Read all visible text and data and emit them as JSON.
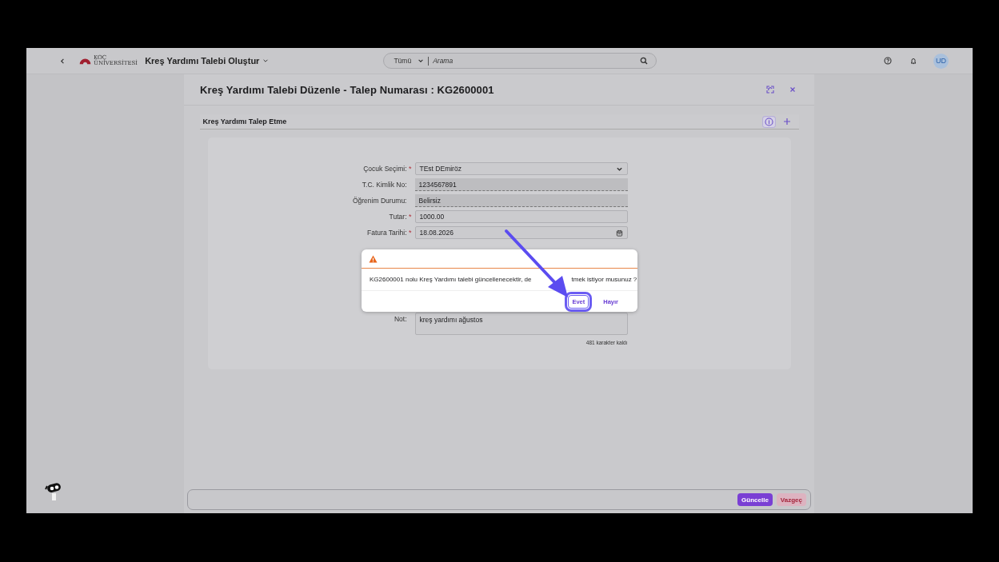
{
  "header": {
    "logo_lines": [
      "KOÇ",
      "ÜNİVERSİTESİ"
    ],
    "app_title": "Kreş Yardımı Talebi Oluştur",
    "search": {
      "scope": "Tümü",
      "placeholder": "Arama"
    },
    "avatar": "UD"
  },
  "page_title": "Kreş Yardımı Talebi Düzenle - Talep Numarası : KG2600001",
  "section_title": "Kreş Yardımı Talep Etme",
  "fields": [
    {
      "label": "Çocuk Seçimi:",
      "required_mark": "*",
      "kind": "select",
      "value": "TEst DEmiröz"
    },
    {
      "label": "T.C. Kimlik No:",
      "kind": "readonly",
      "value": "1234567891"
    },
    {
      "label": "Öğrenim Durumu:",
      "kind": "readonly",
      "value": "Belirsiz"
    },
    {
      "label": "Tutar:",
      "required_mark": "*",
      "kind": "text",
      "value": "1000.00"
    },
    {
      "label": "Fatura Tarihi:",
      "required_mark": "*",
      "kind": "date",
      "value": "18.08.2026"
    }
  ],
  "note": {
    "label": "Not:",
    "value": "kreş yardımı ağustos",
    "counter": "481 karakter kaldı"
  },
  "dialog": {
    "message_visible_parts": [
      "KG2600001 nolu Kreş Yardımı talebi güncellenecektir, de",
      "tmek istiyor musunuz ?"
    ],
    "buttons": [
      {
        "label": "Evet",
        "highlighted": true
      },
      {
        "label": "Hayır",
        "highlighted": false
      }
    ]
  },
  "footer_buttons": [
    {
      "label": "Güncelle",
      "kind": "primary"
    },
    {
      "label": "Vazgeç",
      "kind": "reject"
    }
  ]
}
